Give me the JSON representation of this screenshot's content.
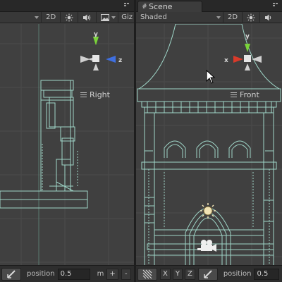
{
  "left_view": {
    "toolbar": {
      "mode_2d": "2D",
      "gizmos_label": "Giz"
    },
    "view_label": "Right",
    "gizmo": {
      "y_label": "y",
      "z_label": "z"
    },
    "bottom": {
      "position_label": "position",
      "position_value": "0.5",
      "unit_label": "m",
      "plus_label": "+",
      "minus_label": "-"
    }
  },
  "right_view": {
    "tab_label": "Scene",
    "toolbar": {
      "shading_mode": "Shaded",
      "mode_2d": "2D"
    },
    "view_label": "Front",
    "gizmo": {
      "y_label": "y",
      "x_label": "x"
    },
    "bottom": {
      "axis_x": "X",
      "axis_y": "Y",
      "axis_z": "Z",
      "position_label": "position",
      "position_value": "0.5"
    }
  },
  "colors": {
    "wireframe": "#9fd6c8",
    "grid": "#4f4f4f",
    "axis_y": "#7ad33a",
    "axis_z": "#3f6fe0",
    "axis_x": "#d93a2a",
    "gizmo_center": "#e6e6e6"
  },
  "icons": {
    "sun": "sun-icon",
    "audio": "audio-icon",
    "image_effects": "image-effects-icon",
    "snap": "snap-icon",
    "grid_snap": "grid-snap-icon",
    "camera": "camera-icon",
    "light": "light-icon"
  }
}
